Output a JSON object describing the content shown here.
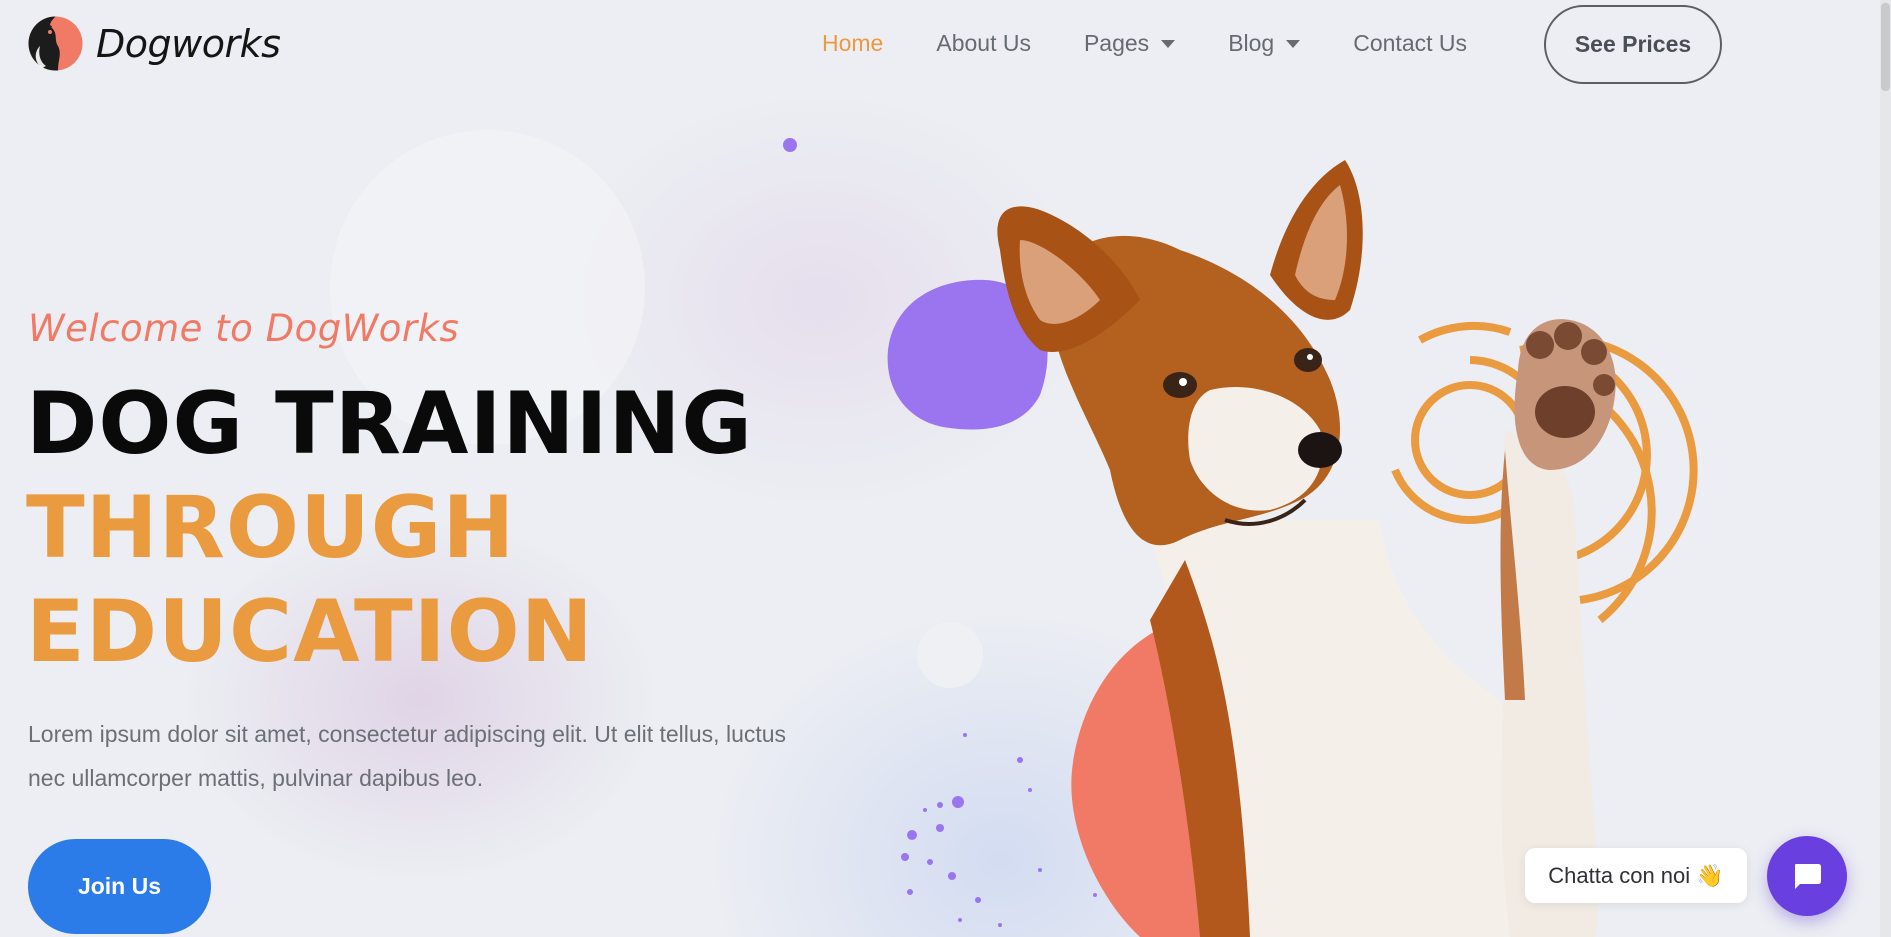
{
  "brand": {
    "name": "Dogworks",
    "logo_icon": "dog-logo-icon"
  },
  "nav": {
    "items": [
      {
        "label": "Home",
        "active": true,
        "dropdown": false
      },
      {
        "label": "About Us",
        "active": false,
        "dropdown": false
      },
      {
        "label": "Pages",
        "active": false,
        "dropdown": true
      },
      {
        "label": "Blog",
        "active": false,
        "dropdown": true
      },
      {
        "label": "Contact Us",
        "active": false,
        "dropdown": false
      }
    ],
    "cta_label": "See Prices"
  },
  "hero": {
    "welcome": "Welcome to DogWorks",
    "headline_line1": "DOG TRAINING",
    "headline_line2": "THROUGH",
    "headline_line3": "EDUCATION",
    "paragraph": "Lorem ipsum dolor sit amet, consectetur adipiscing elit. Ut elit tellus, luctus nec ullamcorper mattis, pulvinar dapibus leo.",
    "join_label": "Join Us",
    "image": "dog-raising-paw"
  },
  "chat": {
    "bubble_text": "Chatta con noi 👋",
    "button_icon": "chat-icon"
  },
  "colors": {
    "accent_orange": "#ea9a3f",
    "accent_coral": "#f07a66",
    "accent_purple": "#9b74ef",
    "button_blue": "#2b7be8",
    "chat_purple": "#6a3fe0"
  }
}
